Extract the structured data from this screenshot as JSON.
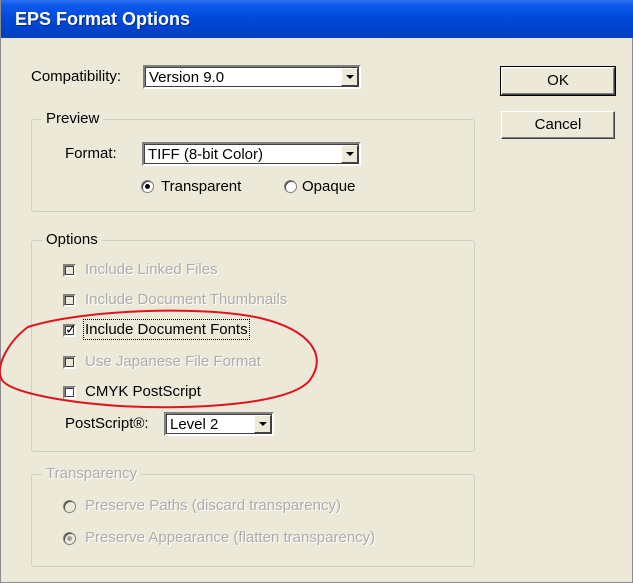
{
  "window": {
    "title": "EPS Format Options"
  },
  "compatibility": {
    "label": "Compatibility:",
    "value": "Version 9.0"
  },
  "preview": {
    "title": "Preview",
    "format_label": "Format:",
    "format_value": "TIFF (8-bit Color)",
    "transparent_label": "Transparent",
    "opaque_label": "Opaque",
    "selected": "Transparent"
  },
  "options": {
    "title": "Options",
    "items": [
      {
        "label": "Include Linked Files",
        "checked": false,
        "enabled": false
      },
      {
        "label": "Include Document Thumbnails",
        "checked": false,
        "enabled": false
      },
      {
        "label": "Include Document Fonts",
        "checked": true,
        "enabled": true
      },
      {
        "label": "Use Japanese File Format",
        "checked": false,
        "enabled": false
      },
      {
        "label": "CMYK PostScript",
        "checked": false,
        "enabled": true
      }
    ],
    "postscript_label": "PostScript®:",
    "postscript_value": "Level 2"
  },
  "transparency": {
    "title": "Transparency",
    "preserve_paths_label": "Preserve Paths (discard transparency)",
    "preserve_appearance_label": "Preserve Appearance (flatten transparency)",
    "selected": "Preserve Appearance"
  },
  "buttons": {
    "ok": "OK",
    "cancel": "Cancel"
  },
  "annotation": {
    "color": "#e0141e",
    "shape": "ellipse"
  }
}
